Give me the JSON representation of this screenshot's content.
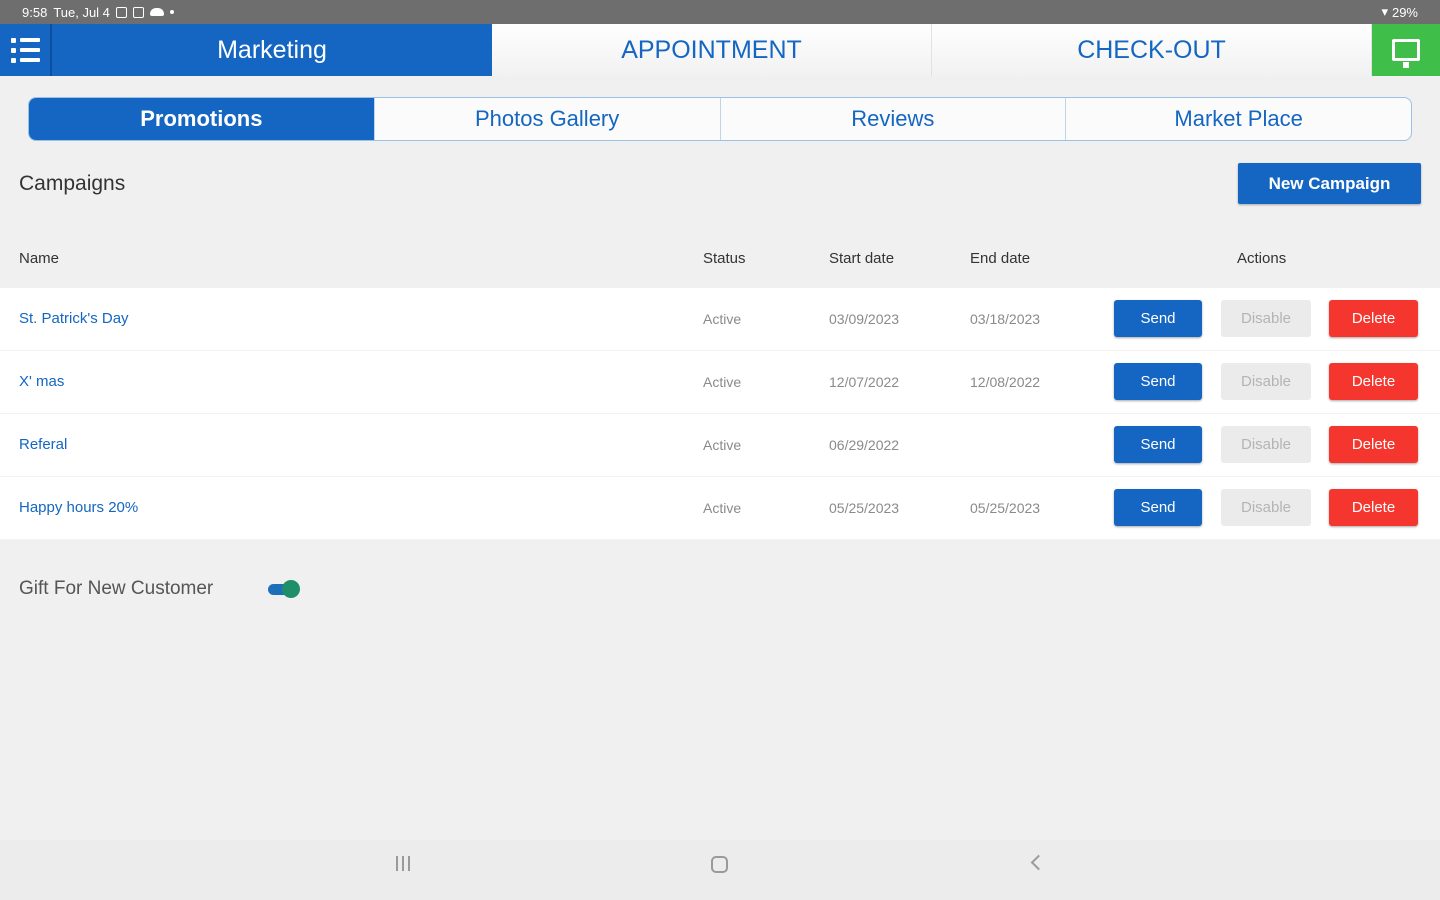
{
  "status_bar": {
    "time": "9:58",
    "date": "Tue, Jul 4",
    "battery": "29%"
  },
  "topnav": {
    "tabs": [
      {
        "label": "Marketing"
      },
      {
        "label": "APPOINTMENT"
      },
      {
        "label": "CHECK-OUT"
      }
    ]
  },
  "subtabs": [
    {
      "label": "Promotions"
    },
    {
      "label": "Photos Gallery"
    },
    {
      "label": "Reviews"
    },
    {
      "label": "Market Place"
    }
  ],
  "campaigns": {
    "title": "Campaigns",
    "new_button": "New Campaign",
    "columns": {
      "name": "Name",
      "status": "Status",
      "start": "Start date",
      "end": "End date",
      "actions": "Actions"
    },
    "rows": [
      {
        "name": "St. Patrick's Day",
        "status": "Active",
        "start": "03/09/2023",
        "end": "03/18/2023"
      },
      {
        "name": "X' mas",
        "status": "Active",
        "start": "12/07/2022",
        "end": "12/08/2022"
      },
      {
        "name": "Referal",
        "status": "Active",
        "start": "06/29/2022",
        "end": ""
      },
      {
        "name": "Happy hours 20%",
        "status": "Active",
        "start": "05/25/2023",
        "end": "05/25/2023"
      }
    ],
    "actions": {
      "send": "Send",
      "disable": "Disable",
      "delete": "Delete"
    }
  },
  "gift": {
    "label": "Gift For New Customer",
    "enabled": true
  },
  "colors": {
    "primary": "#1466c2",
    "delete": "#f5362e",
    "screen_button": "#3fbf4a"
  }
}
